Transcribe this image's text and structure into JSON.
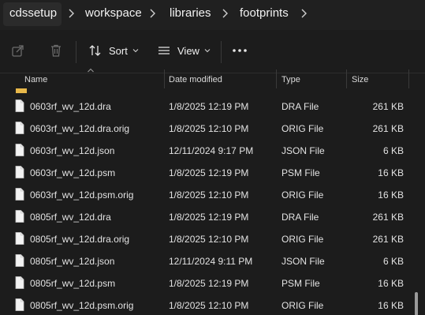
{
  "breadcrumb": {
    "items": [
      "cdssetup",
      "workspace",
      "libraries",
      "footprints"
    ]
  },
  "toolbar": {
    "share_icon": "share-icon",
    "delete_icon": "trash-icon",
    "sort_label": "Sort",
    "view_label": "View",
    "more_icon": "more-icon"
  },
  "columns": {
    "name": "Name",
    "date": "Date modified",
    "type": "Type",
    "size": "Size"
  },
  "files": [
    {
      "name": "0603rf_wv_12d.dra",
      "date": "1/8/2025 12:19 PM",
      "type": "DRA File",
      "size": "261 KB"
    },
    {
      "name": "0603rf_wv_12d.dra.orig",
      "date": "1/8/2025 12:10 PM",
      "type": "ORIG File",
      "size": "261 KB"
    },
    {
      "name": "0603rf_wv_12d.json",
      "date": "12/11/2024 9:17 PM",
      "type": "JSON File",
      "size": "6 KB"
    },
    {
      "name": "0603rf_wv_12d.psm",
      "date": "1/8/2025 12:19 PM",
      "type": "PSM File",
      "size": "16 KB"
    },
    {
      "name": "0603rf_wv_12d.psm.orig",
      "date": "1/8/2025 12:10 PM",
      "type": "ORIG File",
      "size": "16 KB"
    },
    {
      "name": "0805rf_wv_12d.dra",
      "date": "1/8/2025 12:19 PM",
      "type": "DRA File",
      "size": "261 KB"
    },
    {
      "name": "0805rf_wv_12d.dra.orig",
      "date": "1/8/2025 12:10 PM",
      "type": "ORIG File",
      "size": "261 KB"
    },
    {
      "name": "0805rf_wv_12d.json",
      "date": "12/11/2024 9:11 PM",
      "type": "JSON File",
      "size": "6 KB"
    },
    {
      "name": "0805rf_wv_12d.psm",
      "date": "1/8/2025 12:19 PM",
      "type": "PSM File",
      "size": "16 KB"
    },
    {
      "name": "0805rf_wv_12d.psm.orig",
      "date": "1/8/2025 12:10 PM",
      "type": "ORIG File",
      "size": "16 KB"
    }
  ],
  "colors": {
    "background": "#1c1c1c",
    "text": "#e2e2e2",
    "folder": "#e8b84a"
  }
}
